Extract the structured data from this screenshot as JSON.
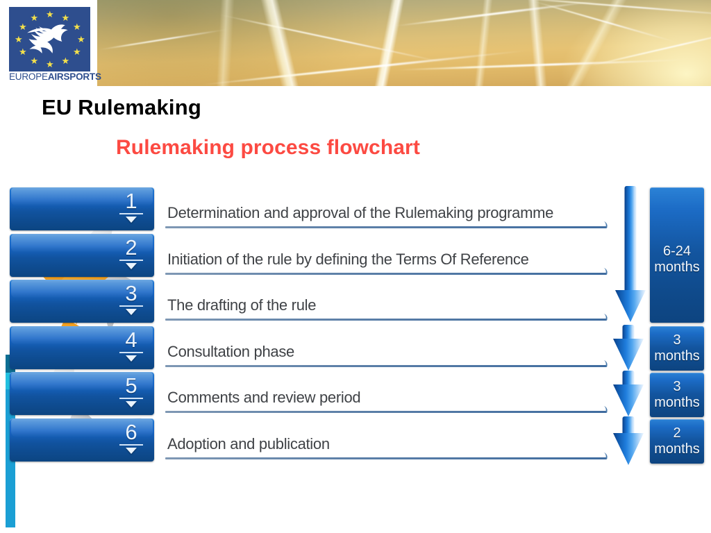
{
  "header": {
    "logo": {
      "name": "europe-airsports-logo",
      "wordmark_light": "EUROPE",
      "wordmark_bold": "AIRSPORTS",
      "flag_color": "#2e4e8e",
      "star_color": "#f4e04b",
      "star_count": 12
    },
    "banner": {
      "name": "sky-contrails-photo",
      "description": "Golden sunset sky with aircraft contrails"
    }
  },
  "titles": {
    "main": "EU Rulemaking",
    "main_color": "#000000",
    "subtitle": "Rulemaking process flowchart",
    "subtitle_color": "#fc4a42"
  },
  "accent": {
    "bar_color": "#1b9fd4",
    "bar_color_dark": "#0d6e93",
    "bar_color_light": "#22c0e0"
  },
  "flowchart": {
    "step_box_color": "#1866c6",
    "steps": [
      {
        "number": "1",
        "label": "Determination and approval of the Rulemaking programme"
      },
      {
        "number": "2",
        "label": "Initiation of the rule by defining the Terms Of Reference"
      },
      {
        "number": "3",
        "label": "The drafting of the rule"
      },
      {
        "number": "4",
        "label": "Consultation phase"
      },
      {
        "number": "5",
        "label": "Comments and review period"
      },
      {
        "number": "6",
        "label": "Adoption and publication"
      }
    ],
    "durations": [
      {
        "value": "6-24",
        "unit": "months",
        "spans_steps": "1-3"
      },
      {
        "value": "3",
        "unit": "months",
        "spans_steps": "4"
      },
      {
        "value": "3",
        "unit": "months",
        "spans_steps": "5"
      },
      {
        "value": "2",
        "unit": "months",
        "spans_steps": "6"
      }
    ],
    "arrow_color": "#1f7ddc"
  }
}
